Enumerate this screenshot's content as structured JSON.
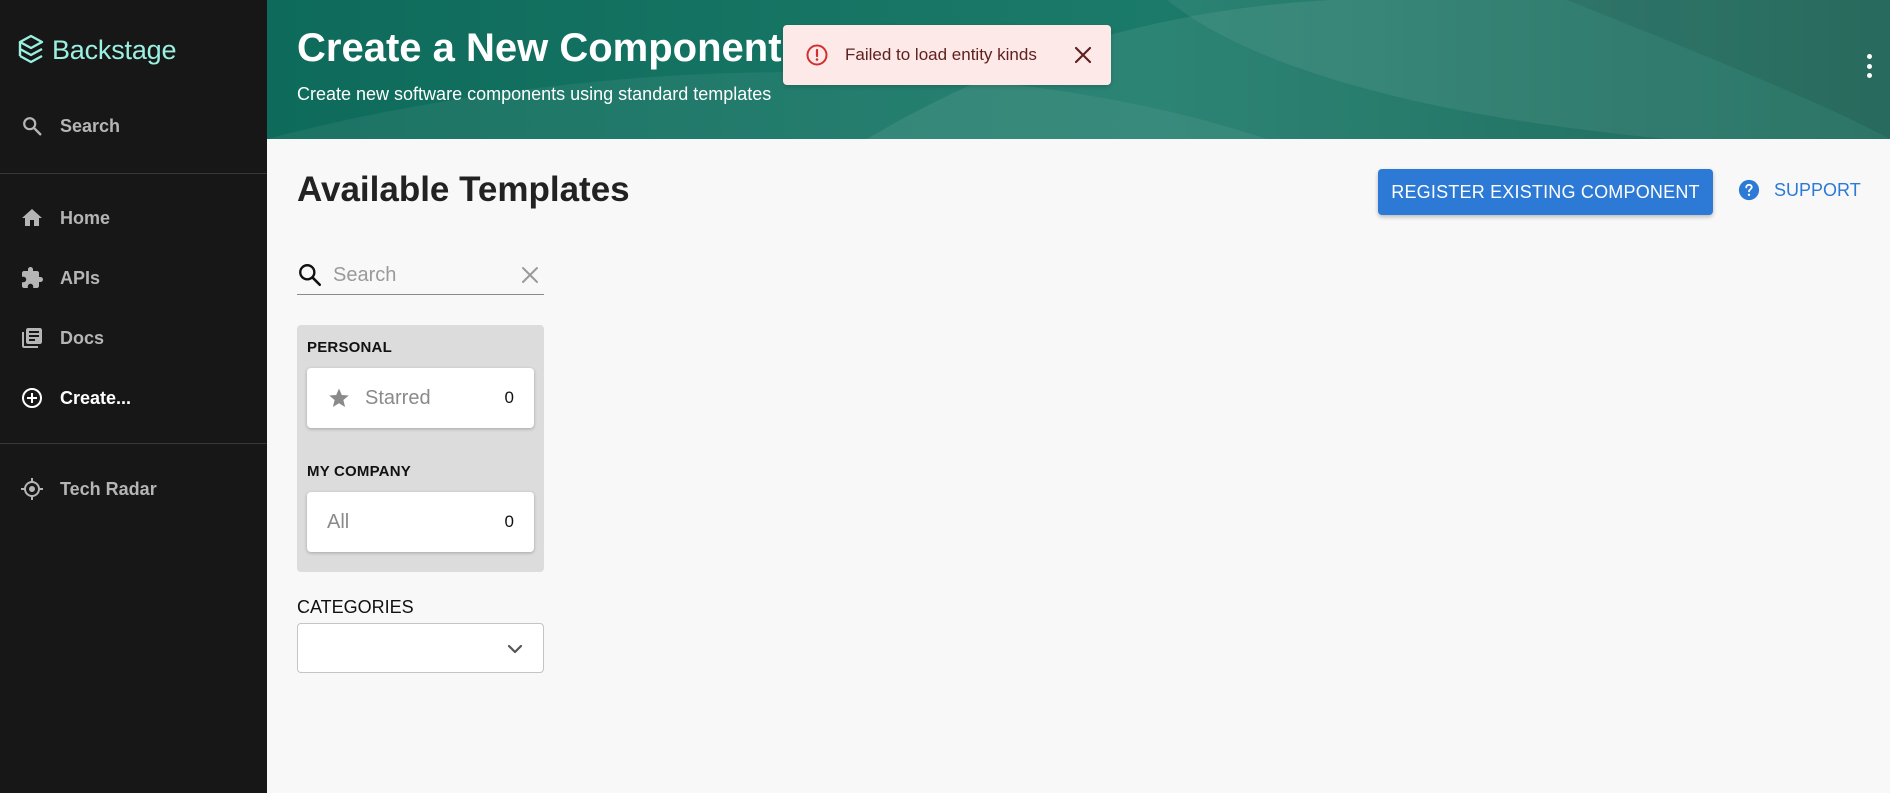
{
  "sidebar": {
    "logo": "Backstage",
    "items": [
      {
        "label": "Search",
        "icon": "search-icon"
      },
      {
        "label": "Home",
        "icon": "home-icon"
      },
      {
        "label": "APIs",
        "icon": "puzzle-icon"
      },
      {
        "label": "Docs",
        "icon": "library-books-icon"
      },
      {
        "label": "Create...",
        "icon": "add-circle-icon"
      },
      {
        "label": "Tech Radar",
        "icon": "radar-icon"
      }
    ]
  },
  "header": {
    "title": "Create a New Component",
    "subtitle": "Create new software components using standard templates"
  },
  "snackbar": {
    "message": "Failed to load entity kinds"
  },
  "main": {
    "title": "Available Templates",
    "register_label": "REGISTER EXISTING COMPONENT",
    "support_label": "SUPPORT",
    "search_placeholder": "Search",
    "filters": {
      "personal_label": "PERSONAL",
      "starred_label": "Starred",
      "starred_count": "0",
      "company_label": "MY COMPANY",
      "all_label": "All",
      "all_count": "0"
    },
    "categories_label": "CATEGORIES"
  },
  "colors": {
    "sidebar_bg": "#171717",
    "logo": "#9bf0e1",
    "header_bg": "#0b5e4f",
    "primary": "#2c7ad6",
    "error": "#d32f2f",
    "snackbar_bg": "#fde9e7"
  }
}
